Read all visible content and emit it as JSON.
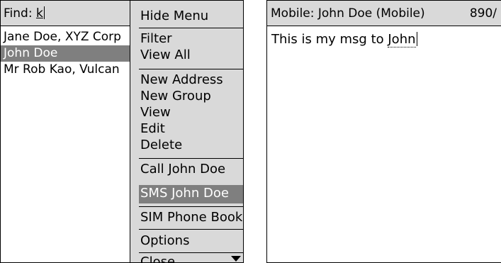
{
  "left": {
    "find_label": "Find:",
    "find_value": "k",
    "contacts": [
      {
        "name": "Jane Doe, XYZ Corp",
        "selected": false
      },
      {
        "name": "John Doe",
        "selected": true
      },
      {
        "name": "Mr Rob Kao, Vulcan",
        "selected": false
      }
    ]
  },
  "menu": {
    "items": [
      "Hide Menu",
      "Filter",
      "View All",
      "New Address",
      "New Group",
      "View",
      "Edit",
      "Delete",
      "Call John Doe",
      "SMS John Doe",
      "SIM Phone Book",
      "Options",
      "Close"
    ],
    "highlighted": "SMS John Doe"
  },
  "right": {
    "title": "Mobile: John Doe (Mobile)",
    "char_count": "890/",
    "message_prefix": "This is my msg to ",
    "message_name": "John"
  },
  "colors": {
    "header_bg": "#d9d9d9",
    "selection_bg": "#7f7f7f",
    "selection_fg": "#ffffff"
  }
}
